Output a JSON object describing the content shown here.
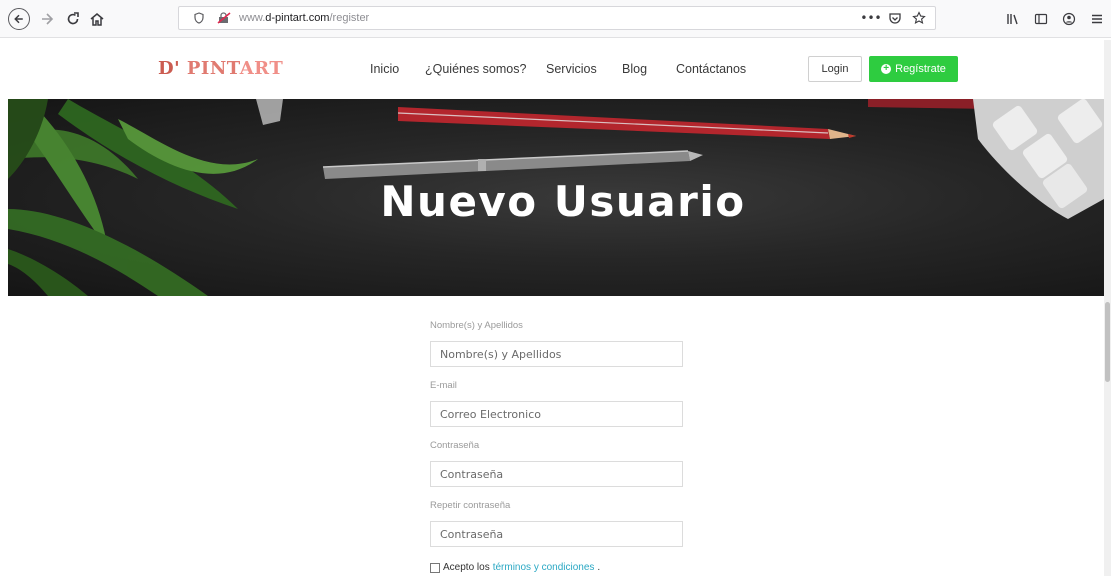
{
  "browser": {
    "url_prefix": "www.",
    "url_domain": "d-pintart.com",
    "url_path": "/register",
    "more_label": "•••"
  },
  "header": {
    "logo": {
      "part1": "D' ",
      "part2": "PINT",
      "part3": "ART"
    },
    "nav": [
      {
        "label": "Inicio"
      },
      {
        "label": "¿Quiénes somos?"
      },
      {
        "label": "Servicios"
      },
      {
        "label": "Blog"
      },
      {
        "label": "Contáctanos"
      }
    ],
    "login_label": "Login",
    "register_label": "Regístrate"
  },
  "hero": {
    "title": "Nuevo Usuario"
  },
  "form": {
    "fields": [
      {
        "label": "Nombre(s) y Apellidos",
        "placeholder": "Nombre(s) y Apellidos"
      },
      {
        "label": "E-mail",
        "placeholder": "Correo Electronico"
      },
      {
        "label": "Contraseña",
        "placeholder": "Contraseña"
      },
      {
        "label": "Repetir contraseña",
        "placeholder": "Contraseña"
      }
    ],
    "terms_prefix": "Acepto los",
    "terms_link": "términos y condiciones",
    "terms_suffix": ".",
    "terms_checked": false
  },
  "colors": {
    "register_green": "#2ecc40",
    "link_blue": "#2aa8c4",
    "logo_red": "#c0392b"
  }
}
